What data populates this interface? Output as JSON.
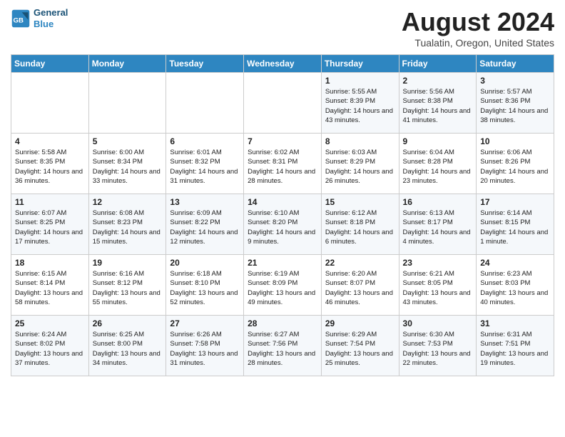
{
  "header": {
    "logo_line1": "General",
    "logo_line2": "Blue",
    "month_year": "August 2024",
    "location": "Tualatin, Oregon, United States"
  },
  "days_of_week": [
    "Sunday",
    "Monday",
    "Tuesday",
    "Wednesday",
    "Thursday",
    "Friday",
    "Saturday"
  ],
  "weeks": [
    [
      {
        "day": "",
        "sunrise": "",
        "sunset": "",
        "daylight": ""
      },
      {
        "day": "",
        "sunrise": "",
        "sunset": "",
        "daylight": ""
      },
      {
        "day": "",
        "sunrise": "",
        "sunset": "",
        "daylight": ""
      },
      {
        "day": "",
        "sunrise": "",
        "sunset": "",
        "daylight": ""
      },
      {
        "day": "1",
        "sunrise": "5:55 AM",
        "sunset": "8:39 PM",
        "daylight": "14 hours and 43 minutes."
      },
      {
        "day": "2",
        "sunrise": "5:56 AM",
        "sunset": "8:38 PM",
        "daylight": "14 hours and 41 minutes."
      },
      {
        "day": "3",
        "sunrise": "5:57 AM",
        "sunset": "8:36 PM",
        "daylight": "14 hours and 38 minutes."
      }
    ],
    [
      {
        "day": "4",
        "sunrise": "5:58 AM",
        "sunset": "8:35 PM",
        "daylight": "14 hours and 36 minutes."
      },
      {
        "day": "5",
        "sunrise": "6:00 AM",
        "sunset": "8:34 PM",
        "daylight": "14 hours and 33 minutes."
      },
      {
        "day": "6",
        "sunrise": "6:01 AM",
        "sunset": "8:32 PM",
        "daylight": "14 hours and 31 minutes."
      },
      {
        "day": "7",
        "sunrise": "6:02 AM",
        "sunset": "8:31 PM",
        "daylight": "14 hours and 28 minutes."
      },
      {
        "day": "8",
        "sunrise": "6:03 AM",
        "sunset": "8:29 PM",
        "daylight": "14 hours and 26 minutes."
      },
      {
        "day": "9",
        "sunrise": "6:04 AM",
        "sunset": "8:28 PM",
        "daylight": "14 hours and 23 minutes."
      },
      {
        "day": "10",
        "sunrise": "6:06 AM",
        "sunset": "8:26 PM",
        "daylight": "14 hours and 20 minutes."
      }
    ],
    [
      {
        "day": "11",
        "sunrise": "6:07 AM",
        "sunset": "8:25 PM",
        "daylight": "14 hours and 17 minutes."
      },
      {
        "day": "12",
        "sunrise": "6:08 AM",
        "sunset": "8:23 PM",
        "daylight": "14 hours and 15 minutes."
      },
      {
        "day": "13",
        "sunrise": "6:09 AM",
        "sunset": "8:22 PM",
        "daylight": "14 hours and 12 minutes."
      },
      {
        "day": "14",
        "sunrise": "6:10 AM",
        "sunset": "8:20 PM",
        "daylight": "14 hours and 9 minutes."
      },
      {
        "day": "15",
        "sunrise": "6:12 AM",
        "sunset": "8:18 PM",
        "daylight": "14 hours and 6 minutes."
      },
      {
        "day": "16",
        "sunrise": "6:13 AM",
        "sunset": "8:17 PM",
        "daylight": "14 hours and 4 minutes."
      },
      {
        "day": "17",
        "sunrise": "6:14 AM",
        "sunset": "8:15 PM",
        "daylight": "14 hours and 1 minute."
      }
    ],
    [
      {
        "day": "18",
        "sunrise": "6:15 AM",
        "sunset": "8:14 PM",
        "daylight": "13 hours and 58 minutes."
      },
      {
        "day": "19",
        "sunrise": "6:16 AM",
        "sunset": "8:12 PM",
        "daylight": "13 hours and 55 minutes."
      },
      {
        "day": "20",
        "sunrise": "6:18 AM",
        "sunset": "8:10 PM",
        "daylight": "13 hours and 52 minutes."
      },
      {
        "day": "21",
        "sunrise": "6:19 AM",
        "sunset": "8:09 PM",
        "daylight": "13 hours and 49 minutes."
      },
      {
        "day": "22",
        "sunrise": "6:20 AM",
        "sunset": "8:07 PM",
        "daylight": "13 hours and 46 minutes."
      },
      {
        "day": "23",
        "sunrise": "6:21 AM",
        "sunset": "8:05 PM",
        "daylight": "13 hours and 43 minutes."
      },
      {
        "day": "24",
        "sunrise": "6:23 AM",
        "sunset": "8:03 PM",
        "daylight": "13 hours and 40 minutes."
      }
    ],
    [
      {
        "day": "25",
        "sunrise": "6:24 AM",
        "sunset": "8:02 PM",
        "daylight": "13 hours and 37 minutes."
      },
      {
        "day": "26",
        "sunrise": "6:25 AM",
        "sunset": "8:00 PM",
        "daylight": "13 hours and 34 minutes."
      },
      {
        "day": "27",
        "sunrise": "6:26 AM",
        "sunset": "7:58 PM",
        "daylight": "13 hours and 31 minutes."
      },
      {
        "day": "28",
        "sunrise": "6:27 AM",
        "sunset": "7:56 PM",
        "daylight": "13 hours and 28 minutes."
      },
      {
        "day": "29",
        "sunrise": "6:29 AM",
        "sunset": "7:54 PM",
        "daylight": "13 hours and 25 minutes."
      },
      {
        "day": "30",
        "sunrise": "6:30 AM",
        "sunset": "7:53 PM",
        "daylight": "13 hours and 22 minutes."
      },
      {
        "day": "31",
        "sunrise": "6:31 AM",
        "sunset": "7:51 PM",
        "daylight": "13 hours and 19 minutes."
      }
    ]
  ],
  "labels": {
    "sunrise": "Sunrise:",
    "sunset": "Sunset:",
    "daylight": "Daylight:"
  }
}
